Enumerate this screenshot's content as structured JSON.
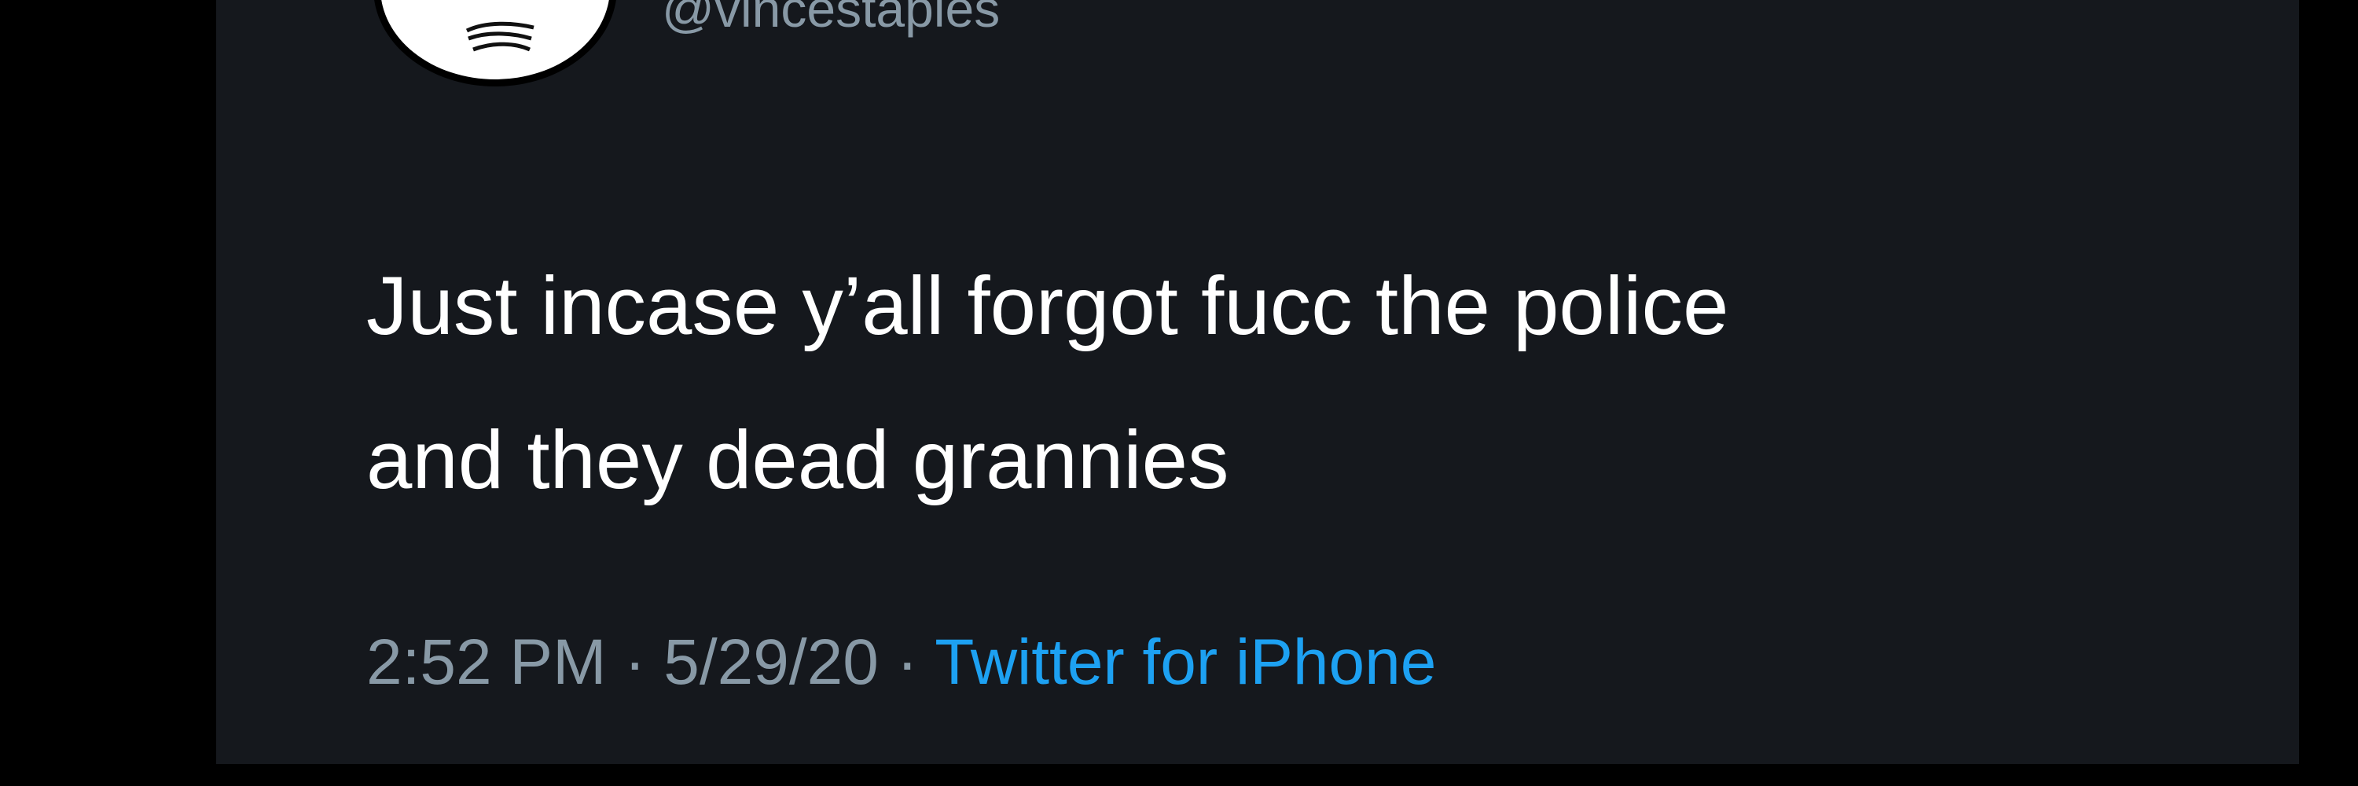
{
  "tweet": {
    "handle": "@vincestaples",
    "avatar_icon": "avatar-icon",
    "text_line1": "Just incase y’all forgot fucc the police",
    "text_line2": "and they dead grannies",
    "time": "2:52 PM",
    "separator": " · ",
    "date": "5/29/20",
    "source": "Twitter for iPhone"
  },
  "colors": {
    "background": "#16202c",
    "text": "#ffffff",
    "secondary": "#8899a6",
    "link": "#1da1f2"
  }
}
